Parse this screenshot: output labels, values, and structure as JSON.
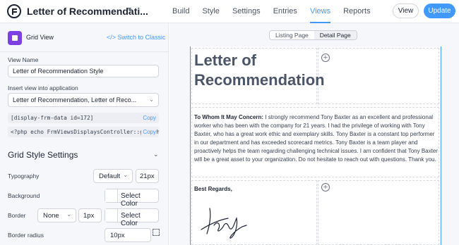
{
  "header": {
    "title": "Letter of Recommendati...",
    "nav": [
      "Build",
      "Style",
      "Settings",
      "Entries",
      "Views",
      "Reports"
    ],
    "active_nav": "Views",
    "view_button": "View",
    "update_button": "Update",
    "accent_color": "#4199fd"
  },
  "sidebar": {
    "view_type": "Grid View",
    "switch_label": "Switch to Classic",
    "view_name_label": "View Name",
    "view_name_value": "Letter of Recommendation Style",
    "insert_label": "Insert view into application",
    "insert_value": "Letter of Recommendation, Letter of Reco...",
    "shortcode": "[display-frm-data id=172]",
    "php_code": "<?php echo FrmViewsDisplaysController::get_shortcode(",
    "copy_label": "Copy",
    "grid_style_title": "Grid Style Settings",
    "typography_label": "Typography",
    "typography_value": "Default",
    "typography_size": "21px",
    "background_label": "Background",
    "select_color": "Select Color",
    "border_label": "Border",
    "border_value": "None",
    "border_size": "1px",
    "border_radius_label": "Border radius",
    "border_radius_value": "10px"
  },
  "canvas": {
    "tabs": [
      "Listing Page",
      "Detail Page"
    ],
    "active_tab": "Detail Page",
    "title": "Letter of Recommendation",
    "letter_greeting": "To Whom It May Concern:",
    "letter_body": " I strongly recommend Tony Baxter as an excellent and professional worker who has been with the company for 21 years. I had the privilege of working with Tony Baxter, who has a great work ethic and exemplary skills. Tony Baxter is a constant top performer in our department and has exceeded scorecard metrics. Tony Baxter is a team player and proactively helps the team regarding challenging technical issues.  I am confident that Tony Baxter will be a great asset to your organization. Do not hesitate to reach out with questions. Thank you.",
    "closing": "Best Regards,"
  }
}
